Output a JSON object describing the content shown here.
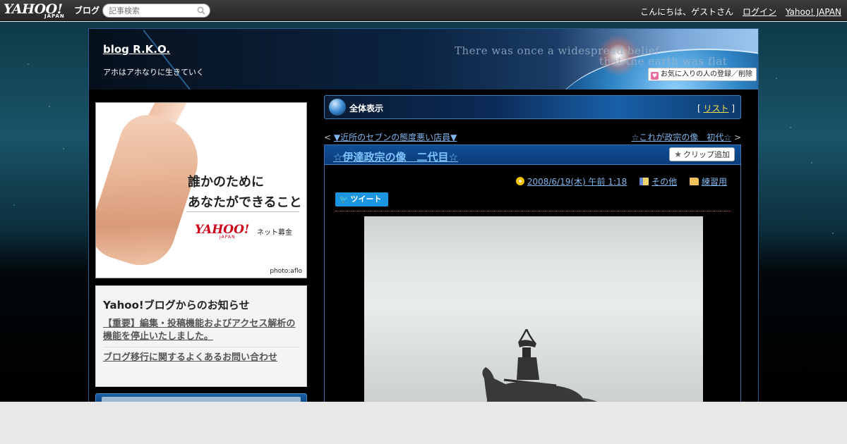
{
  "topbar": {
    "logo_main": "YAHOO!",
    "logo_sub": "JAPAN",
    "service": "ブログ",
    "search_placeholder": "記事検索",
    "greeting": "こんにちは、ゲストさん",
    "login": "ログイン",
    "yahoo_japan": "Yahoo! JAPAN"
  },
  "header": {
    "blog_title": "blog R.K.O.",
    "description": "アホはアホなりに生きていく",
    "tagline_1": "There was once a widespread belief",
    "tagline_2": "that the earth was flat",
    "favorite_button": "お気に入りの人の登録／削除"
  },
  "sidebar": {
    "ad": {
      "line1": "誰かのために",
      "line2": "あなたができること",
      "brand": "YAHOO!",
      "brand_sub": "JAPAN",
      "service": "ネット募金",
      "credit": "photo:aflo"
    },
    "notice": {
      "title": "Yahoo!ブログからのお知らせ",
      "items": [
        "【重要】編集・投稿機能およびアクセス解析の機能を停止いたしました。",
        "ブログ移行に関するよくあるお問い合わせ"
      ]
    }
  },
  "main": {
    "view_label": "全体表示",
    "list_open": "[",
    "list_link": "リスト",
    "list_close": "]",
    "prev_arrow": "<",
    "prev_link": "▼近所のセブンの態度悪い店員▼",
    "next_link": "☆これが政宗の像　初代☆",
    "next_arrow": ">",
    "article": {
      "title": "☆伊達政宗の像　二代目☆",
      "clip_button": "クリップ追加",
      "date": "2008/6/19(木) 午前 1:18",
      "category": "その他",
      "folder": "練習用",
      "tweet": "ツイート"
    }
  },
  "colors": {
    "link": "#7fb6ee",
    "title_link": "#7fc4ff",
    "list_link": "#f5e14a",
    "tweet": "#1b95e0",
    "ad_brand": "#d0021b"
  }
}
